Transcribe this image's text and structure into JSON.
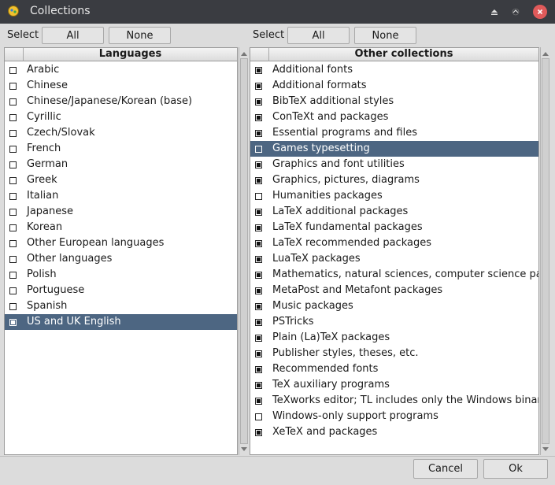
{
  "window": {
    "title": "Collections"
  },
  "left": {
    "select_label": "Select",
    "all_label": "All",
    "none_label": "None",
    "column_header": "Languages",
    "items": [
      {
        "label": "Arabic",
        "checked": false,
        "selected": false
      },
      {
        "label": "Chinese",
        "checked": false,
        "selected": false
      },
      {
        "label": "Chinese/Japanese/Korean (base)",
        "checked": false,
        "selected": false
      },
      {
        "label": "Cyrillic",
        "checked": false,
        "selected": false
      },
      {
        "label": "Czech/Slovak",
        "checked": false,
        "selected": false
      },
      {
        "label": "French",
        "checked": false,
        "selected": false
      },
      {
        "label": "German",
        "checked": false,
        "selected": false
      },
      {
        "label": "Greek",
        "checked": false,
        "selected": false
      },
      {
        "label": "Italian",
        "checked": false,
        "selected": false
      },
      {
        "label": "Japanese",
        "checked": false,
        "selected": false
      },
      {
        "label": "Korean",
        "checked": false,
        "selected": false
      },
      {
        "label": "Other European languages",
        "checked": false,
        "selected": false
      },
      {
        "label": "Other languages",
        "checked": false,
        "selected": false
      },
      {
        "label": "Polish",
        "checked": false,
        "selected": false
      },
      {
        "label": "Portuguese",
        "checked": false,
        "selected": false
      },
      {
        "label": "Spanish",
        "checked": false,
        "selected": false
      },
      {
        "label": "US and UK English",
        "checked": true,
        "selected": true
      }
    ]
  },
  "right": {
    "select_label": "Select",
    "all_label": "All",
    "none_label": "None",
    "column_header": "Other collections",
    "items": [
      {
        "label": "Additional fonts",
        "checked": true,
        "selected": false
      },
      {
        "label": "Additional formats",
        "checked": true,
        "selected": false
      },
      {
        "label": "BibTeX additional styles",
        "checked": true,
        "selected": false
      },
      {
        "label": "ConTeXt and packages",
        "checked": true,
        "selected": false
      },
      {
        "label": "Essential programs and files",
        "checked": true,
        "selected": false
      },
      {
        "label": "Games typesetting",
        "checked": false,
        "selected": true
      },
      {
        "label": "Graphics and font utilities",
        "checked": true,
        "selected": false
      },
      {
        "label": "Graphics, pictures, diagrams",
        "checked": true,
        "selected": false
      },
      {
        "label": "Humanities packages",
        "checked": false,
        "selected": false
      },
      {
        "label": "LaTeX additional packages",
        "checked": true,
        "selected": false
      },
      {
        "label": "LaTeX fundamental packages",
        "checked": true,
        "selected": false
      },
      {
        "label": "LaTeX recommended packages",
        "checked": true,
        "selected": false
      },
      {
        "label": "LuaTeX packages",
        "checked": true,
        "selected": false
      },
      {
        "label": "Mathematics, natural sciences, computer science packages",
        "checked": true,
        "selected": false
      },
      {
        "label": "MetaPost and Metafont packages",
        "checked": true,
        "selected": false
      },
      {
        "label": "Music packages",
        "checked": true,
        "selected": false
      },
      {
        "label": "PSTricks",
        "checked": true,
        "selected": false
      },
      {
        "label": "Plain (La)TeX packages",
        "checked": true,
        "selected": false
      },
      {
        "label": "Publisher styles, theses, etc.",
        "checked": true,
        "selected": false
      },
      {
        "label": "Recommended fonts",
        "checked": true,
        "selected": false
      },
      {
        "label": "TeX auxiliary programs",
        "checked": true,
        "selected": false
      },
      {
        "label": "TeXworks editor; TL includes only the Windows binary",
        "checked": true,
        "selected": false
      },
      {
        "label": "Windows-only support programs",
        "checked": false,
        "selected": false
      },
      {
        "label": "XeTeX and packages",
        "checked": true,
        "selected": false
      }
    ]
  },
  "footer": {
    "cancel_label": "Cancel",
    "ok_label": "Ok"
  },
  "colors": {
    "selection": "#4d6682",
    "titlebar": "#3a3c41",
    "close_button": "#e05a5a"
  },
  "icons": [
    "app-icon",
    "restore-icon",
    "shade-icon",
    "close-icon",
    "scroll-up-icon",
    "scroll-down-icon"
  ]
}
